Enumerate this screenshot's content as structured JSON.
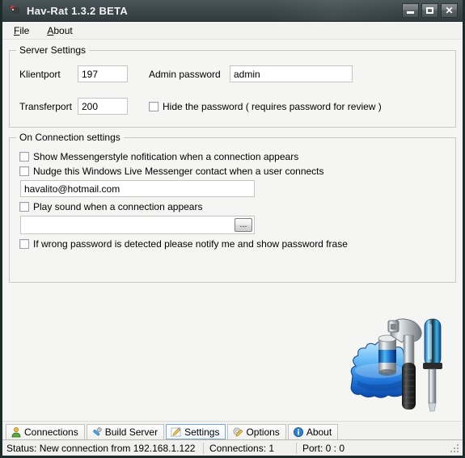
{
  "window": {
    "title": "Hav-Rat 1.3.2 BETA",
    "icon": "rat-icon",
    "controls": {
      "minimize": "minimize-button",
      "maximize": "maximize-button",
      "close": "close-button"
    },
    "titlebar_color": "#3e4a4e",
    "border_color": "#1d2b2b"
  },
  "menu": {
    "items": [
      {
        "label": "File",
        "accel": "F"
      },
      {
        "label": "About",
        "accel": "A"
      }
    ]
  },
  "server_settings": {
    "legend": "Server Settings",
    "klientport": {
      "label": "Klientport",
      "value": "197"
    },
    "transferport": {
      "label": "Transferport",
      "value": "200"
    },
    "admin_password": {
      "label": "Admin password",
      "value": "admin"
    },
    "hide_password": {
      "label": "Hide the password ( requires password for review )",
      "checked": false
    }
  },
  "connection_settings": {
    "legend": "On Connection settings",
    "show_messenger_notification": {
      "label": "Show Messengerstyle nofitication when a connection appears",
      "checked": false
    },
    "nudge_contact": {
      "label": "Nudge this Windows Live Messenger contact when a user connects",
      "checked": false
    },
    "messenger_email": {
      "value": "havalito@hotmail.com",
      "placeholder": ""
    },
    "play_sound": {
      "label": "Play sound when a connection appears",
      "checked": false
    },
    "sound_file": {
      "value": "",
      "placeholder": "",
      "browse_label": "..."
    },
    "wrong_password_notify": {
      "label": "If wrong password is detected please notify me and show password frase",
      "checked": false
    }
  },
  "artwork": {
    "name": "tools-illustration",
    "description": "blue gear with hammer and screwdriver"
  },
  "tabs": [
    {
      "label": "Connections",
      "icon": "user-icon",
      "active": false
    },
    {
      "label": "Build Server",
      "icon": "screwdriver-icon",
      "active": false
    },
    {
      "label": "Settings",
      "icon": "pencil-icon",
      "active": true
    },
    {
      "label": "Options",
      "icon": "gear-pencil-icon",
      "active": false
    },
    {
      "label": "About",
      "icon": "info-icon",
      "active": false
    }
  ],
  "statusbar": {
    "status": "Status: New connection from 192.168.1.122",
    "connections": "Connections: 1",
    "port": "Port: 0 : 0",
    "grip": "resize-grip"
  }
}
